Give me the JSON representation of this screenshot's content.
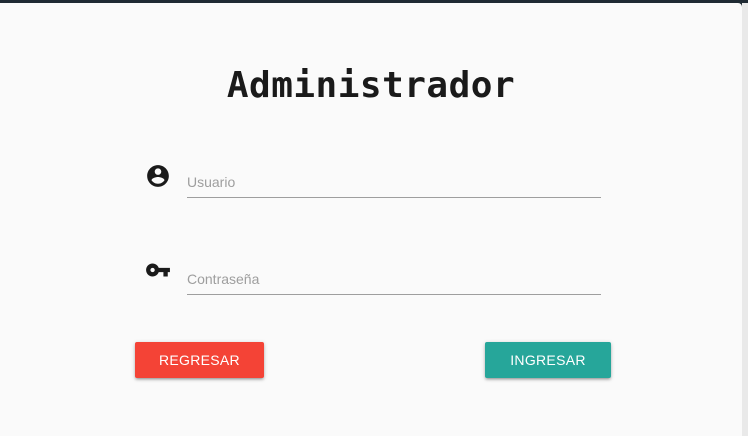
{
  "dialog": {
    "title": "Administrador"
  },
  "form": {
    "username": {
      "placeholder": "Usuario",
      "value": "",
      "icon": "account-circle-icon"
    },
    "password": {
      "placeholder": "Contraseña",
      "value": "",
      "icon": "key-icon"
    }
  },
  "actions": {
    "back_label": "REGRESAR",
    "login_label": "INGRESAR"
  },
  "colors": {
    "back_button": "#f44336",
    "login_button": "#26a69a",
    "background": "#fafafa"
  }
}
